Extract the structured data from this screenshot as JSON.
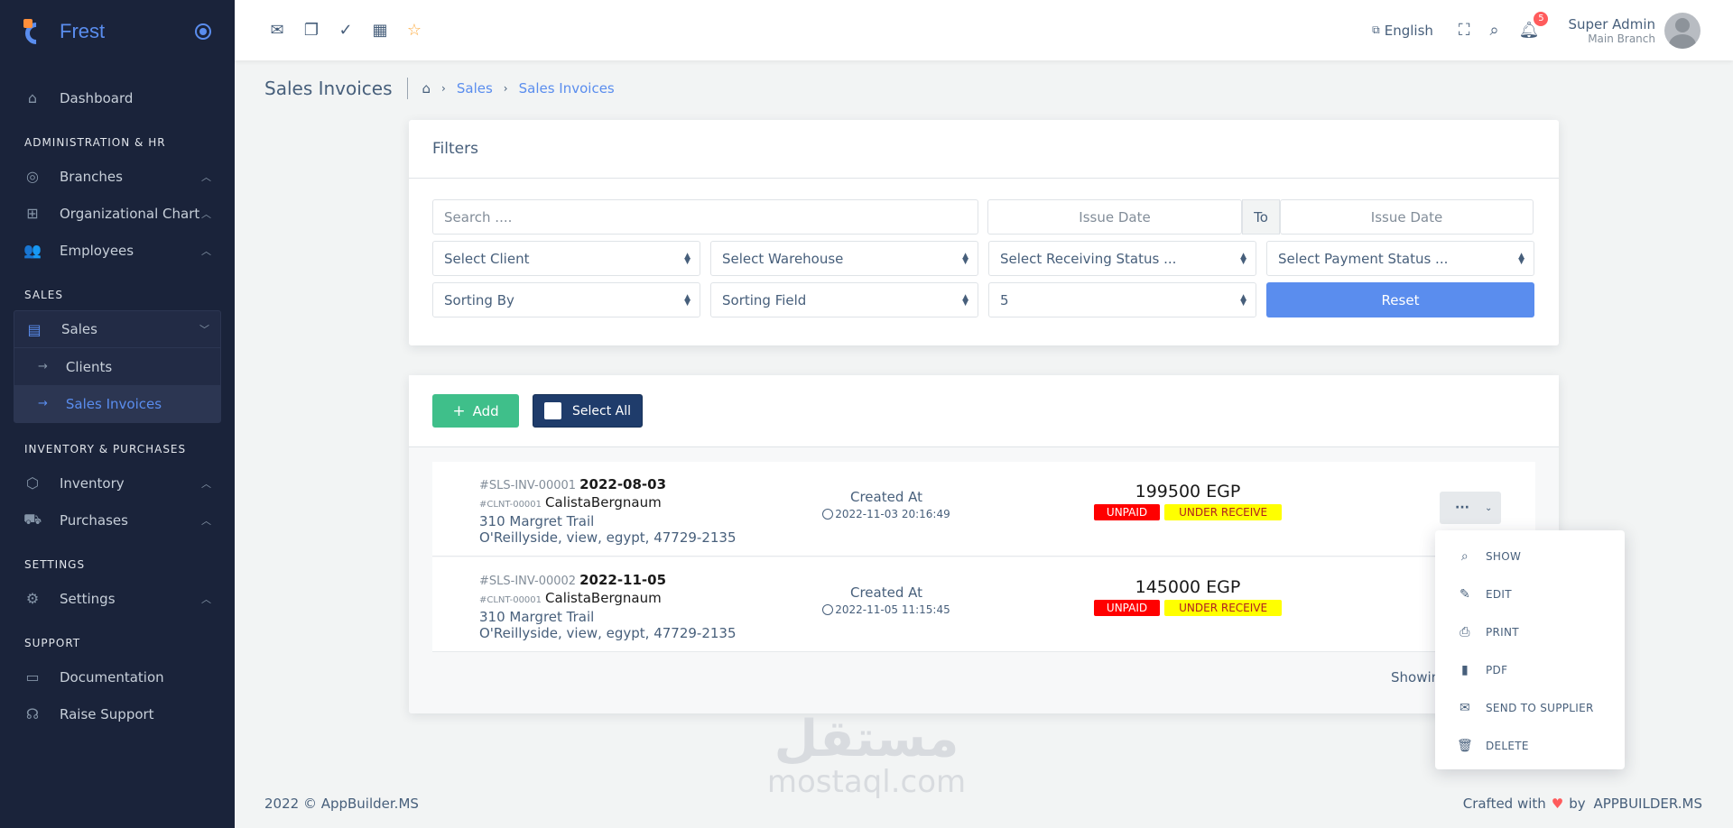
{
  "brand": {
    "name": "Frest"
  },
  "sidebar": {
    "dashboard": "Dashboard",
    "sections": {
      "admin": "ADMINISTRATION & HR",
      "sales": "SALES",
      "inventory": "INVENTORY & PURCHASES",
      "settings": "SETTINGS",
      "support": "SUPPORT"
    },
    "items": {
      "branches": "Branches",
      "org_chart": "Organizational Chart",
      "employees": "Employees",
      "sales": "Sales",
      "clients": "Clients",
      "sales_invoices": "Sales Invoices",
      "inventory": "Inventory",
      "purchases": "Purchases",
      "settings": "Settings",
      "documentation": "Documentation",
      "raise_support": "Raise Support"
    }
  },
  "topbar": {
    "language": "English",
    "notifications_count": "5",
    "user_name": "Super Admin",
    "user_branch": "Main Branch"
  },
  "breadcrumb": {
    "title": "Sales Invoices",
    "items": [
      "Sales",
      "Sales Invoices"
    ]
  },
  "filters": {
    "title": "Filters",
    "search_placeholder": "Search ....",
    "issue_date_from": "Issue Date",
    "to_label": "To",
    "issue_date_to": "Issue Date",
    "client": "Select Client",
    "warehouse": "Select Warehouse",
    "receiving_status": "Select Receiving Status ...",
    "payment_status": "Select Payment Status ...",
    "sorting_by": "Sorting By",
    "sorting_field": "Sorting Field",
    "per_page": "5",
    "reset": "Reset"
  },
  "list": {
    "add": "Add",
    "select_all": "Select All",
    "created_label": "Created At",
    "showing": "Showin",
    "invoices": [
      {
        "id": "#SLS-INV-00001",
        "date": "2022-08-03",
        "client_id": "#CLNT-00001",
        "client_name": "CalistaBergnaum",
        "address1": "310 Margret Trail",
        "address2": "O'Reillyside, view, egypt, 47729-2135",
        "created": "2022-11-03 20:16:49",
        "amount": "199500 EGP",
        "payment": "UNPAID",
        "receive": "UNDER RECEIVE"
      },
      {
        "id": "#SLS-INV-00002",
        "date": "2022-11-05",
        "client_id": "#CLNT-00001",
        "client_name": "CalistaBergnaum",
        "address1": "310 Margret Trail",
        "address2": "O'Reillyside, view, egypt, 47729-2135",
        "created": "2022-11-05 11:15:45",
        "amount": "145000 EGP",
        "payment": "UNPAID",
        "receive": "UNDER RECEIVE"
      }
    ]
  },
  "actions_menu": {
    "trigger": "···",
    "items": [
      "SHOW",
      "EDIT",
      "PRINT",
      "PDF",
      "SEND TO SUPPLIER",
      "DELETE"
    ]
  },
  "watermark": {
    "arabic": "مستقل",
    "latin": "mostaql.com"
  },
  "footer": {
    "left": "2022 © AppBuilder.MS",
    "crafted": "Crafted with",
    "by": "by",
    "brand": "APPBUILDER.MS"
  }
}
